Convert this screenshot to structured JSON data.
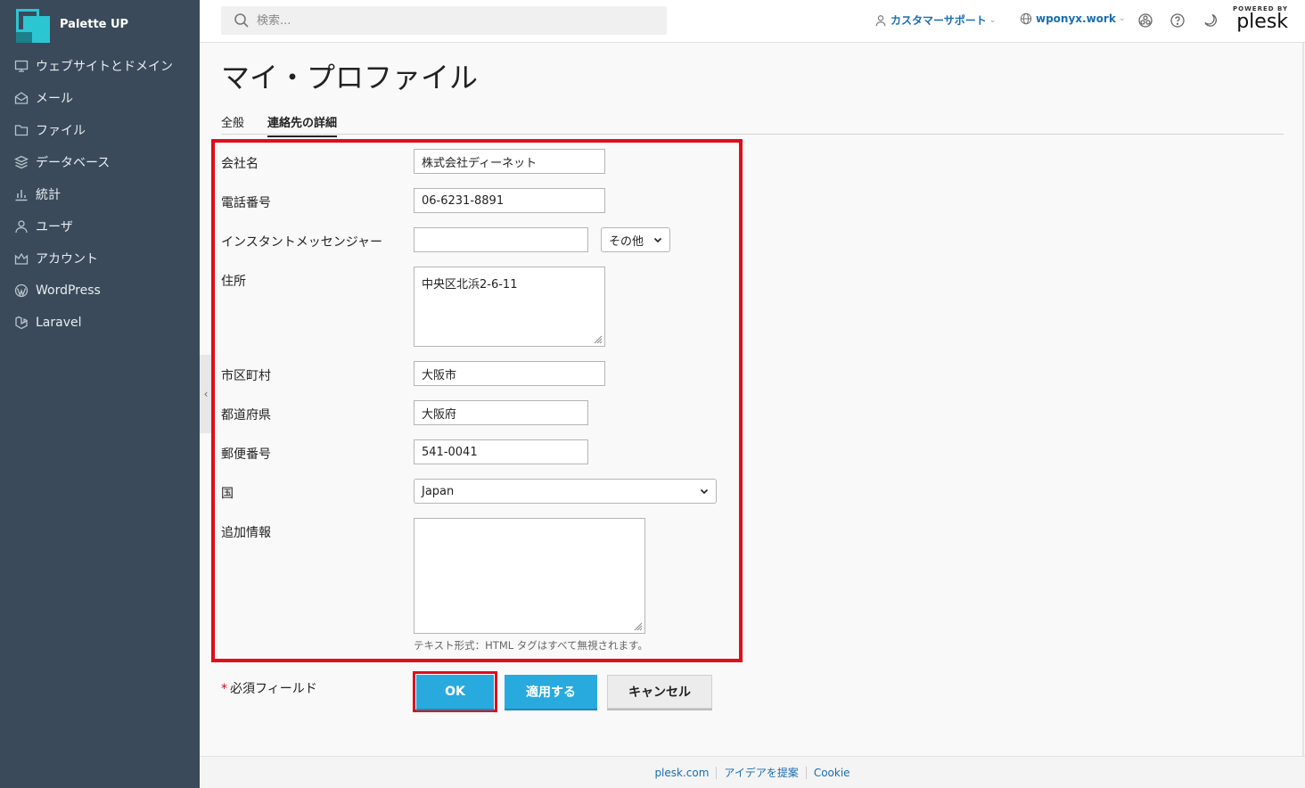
{
  "brand": {
    "name": "Palette UP"
  },
  "sidebar": {
    "items": [
      {
        "label": "ウェブサイトとドメイン",
        "icon": "monitor-icon"
      },
      {
        "label": "メール",
        "icon": "mail-icon"
      },
      {
        "label": "ファイル",
        "icon": "folder-icon"
      },
      {
        "label": "データベース",
        "icon": "database-icon"
      },
      {
        "label": "統計",
        "icon": "bar-chart-icon"
      },
      {
        "label": "ユーザ",
        "icon": "user-icon"
      },
      {
        "label": "アカウント",
        "icon": "crown-icon"
      },
      {
        "label": "WordPress",
        "icon": "wordpress-icon"
      },
      {
        "label": "Laravel",
        "icon": "laravel-icon"
      }
    ]
  },
  "header": {
    "search_placeholder": "検索...",
    "support_label": "カスタマーサポート",
    "domain_label": "wponyx.work",
    "powered_by": "POWERED BY",
    "plesk": "plesk"
  },
  "page": {
    "title": "マイ・プロファイル",
    "tabs": [
      "全般",
      "連絡先の詳細"
    ],
    "active_tab": "連絡先の詳細"
  },
  "form": {
    "company": {
      "label": "会社名",
      "value": "株式会社ディーネット"
    },
    "phone": {
      "label": "電話番号",
      "value": "06-6231-8891"
    },
    "im": {
      "label": "インスタントメッセンジャー",
      "value": "",
      "type_selected": "その他"
    },
    "address": {
      "label": "住所",
      "value": "中央区北浜2-6-11"
    },
    "city": {
      "label": "市区町村",
      "value": "大阪市"
    },
    "state": {
      "label": "都道府県",
      "value": "大阪府"
    },
    "zip": {
      "label": "郵便番号",
      "value": "541-0041"
    },
    "country": {
      "label": "国",
      "value": "Japan"
    },
    "extra": {
      "label": "追加情報",
      "value": "",
      "hint": "テキスト形式：HTML タグはすべて無視されます。"
    }
  },
  "actions": {
    "required_note": "必須フィールド",
    "required_star": "*",
    "ok": "OK",
    "apply": "適用する",
    "cancel": "キャンセル"
  },
  "footer": {
    "links": [
      "plesk.com",
      "アイデアを提案",
      "Cookie"
    ]
  },
  "colors": {
    "sidebar": "#3a4a5a",
    "accent": "#28aade",
    "highlight": "#e00d1a",
    "link": "#1a6db3"
  }
}
